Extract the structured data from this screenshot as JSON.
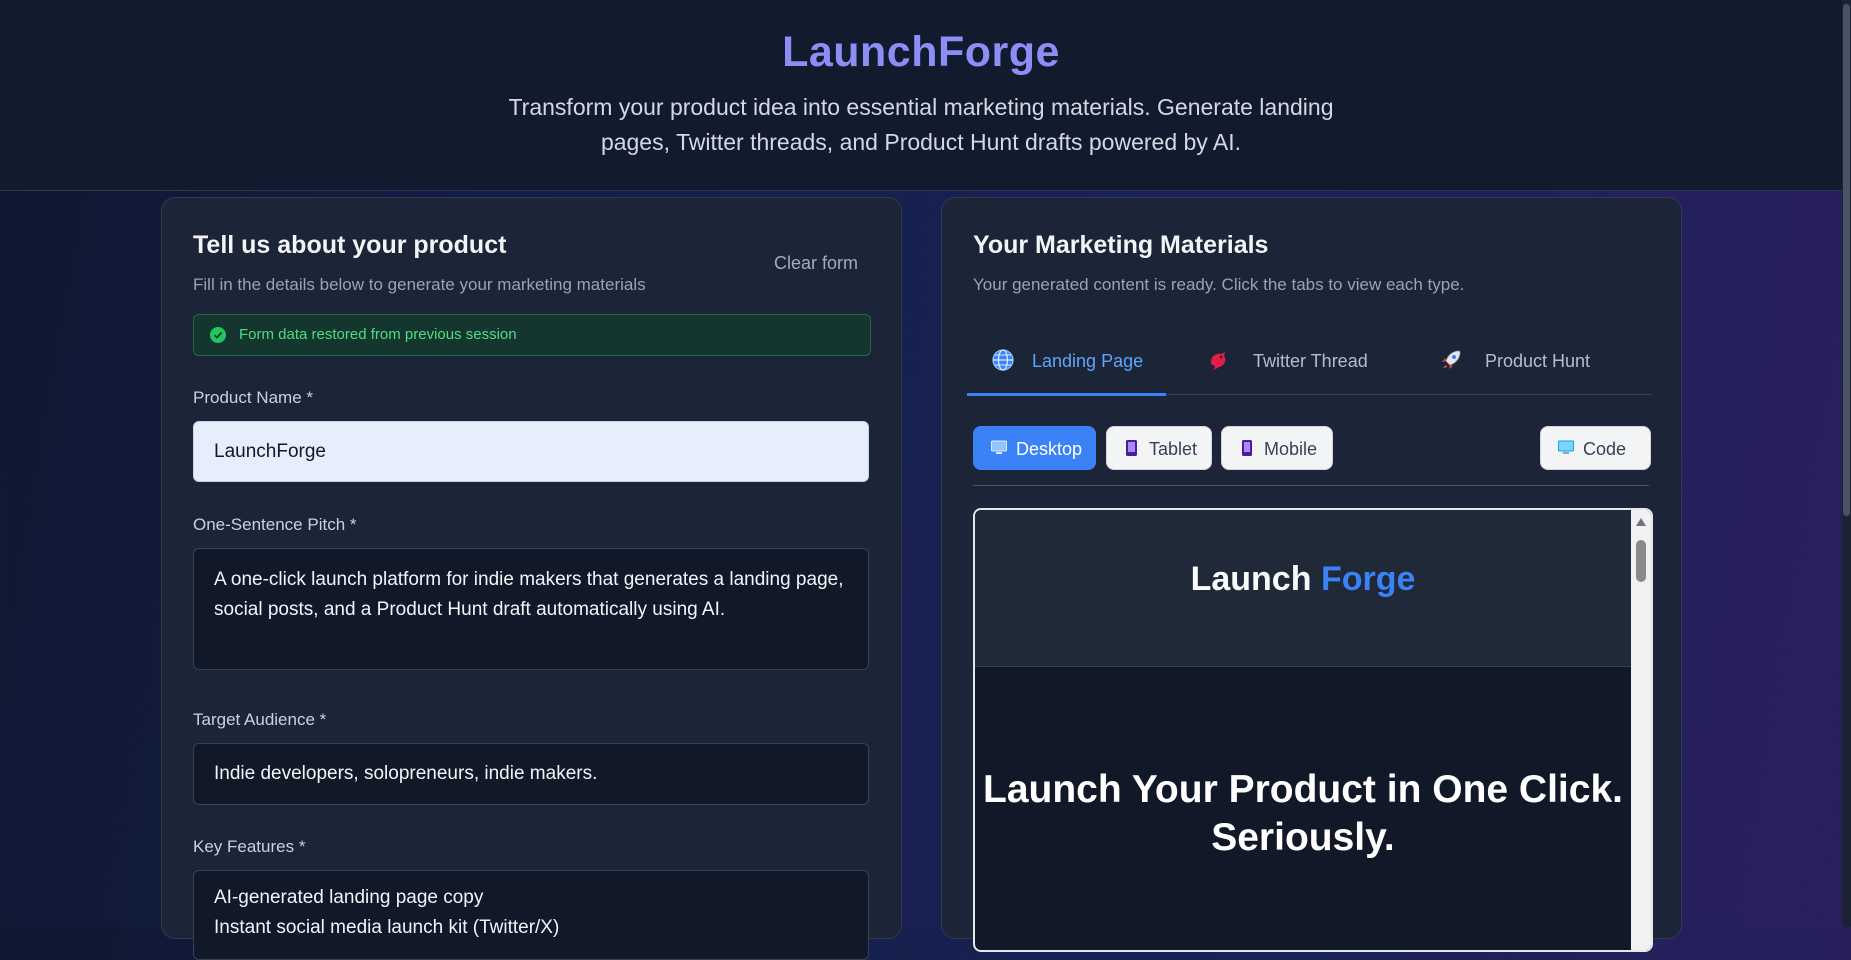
{
  "header": {
    "title": "LaunchForge",
    "tagline": "Transform your product idea into essential marketing materials. Generate landing pages, Twitter threads, and Product Hunt drafts powered by AI."
  },
  "form": {
    "heading": "Tell us about your product",
    "subheading": "Fill in the details below to generate your marketing materials",
    "clear_label": "Clear form",
    "notice": "Form data restored from previous session",
    "product_name": {
      "label": "Product Name *",
      "value": "LaunchForge"
    },
    "pitch": {
      "label": "One-Sentence Pitch *",
      "value": "A one-click launch platform for indie makers that generates a landing page, social posts, and a Product Hunt draft automatically using AI."
    },
    "audience": {
      "label": "Target Audience *",
      "value": "Indie developers, solopreneurs, indie makers."
    },
    "features": {
      "label": "Key Features *",
      "value": "AI-generated landing page copy\nInstant social media launch kit (Twitter/X)"
    }
  },
  "output": {
    "heading": "Your Marketing Materials",
    "subheading": "Your generated content is ready. Click the tabs to view each type.",
    "tabs": [
      {
        "label": "Landing Page",
        "icon": "globe-icon"
      },
      {
        "label": "Twitter Thread",
        "icon": "bird-icon"
      },
      {
        "label": "Product Hunt",
        "icon": "rocket-icon"
      }
    ],
    "view_buttons": {
      "desktop": "Desktop",
      "tablet": "Tablet",
      "mobile": "Mobile",
      "code": "Code"
    },
    "preview": {
      "logo_part1": "Launch",
      "logo_part2": "Forge",
      "hero": "Launch Your Product in One Click.\nSeriously."
    }
  },
  "colors": {
    "accent": "#3b82f6",
    "brand": "#8b8ff5",
    "success": "#4ade80"
  }
}
